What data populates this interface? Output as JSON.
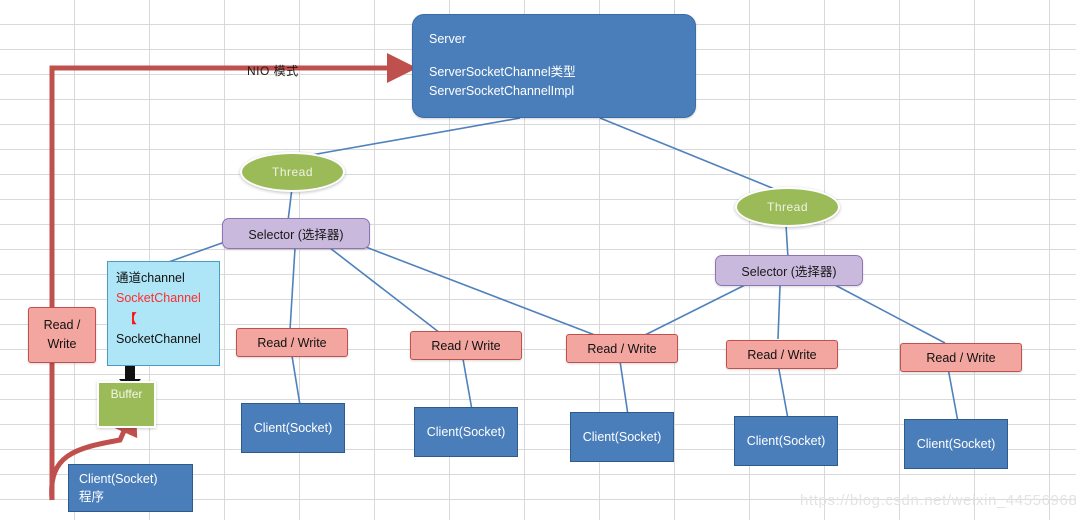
{
  "diagram": {
    "title_label": "NIO 模式",
    "watermark": "https://blog.csdn.net/weixin_44556968",
    "colors": {
      "blue": "#4a7ebb",
      "green": "#9bbb59",
      "purple": "#c9b9dd",
      "pink": "#f3a6a0",
      "cyan": "#aee5f7",
      "red_arrow": "#c0504d",
      "grid": "#d9d9d9",
      "edge_blue": "#4f81bd"
    },
    "server": {
      "line1": "Server",
      "line2": "ServerSocketChannel类型",
      "line3": "ServerSocketChannelImpl"
    },
    "threads": [
      {
        "label": "Thread"
      },
      {
        "label": "Thread"
      }
    ],
    "selectors": [
      {
        "label": "Selector (选择器)"
      },
      {
        "label": "Selector (选择器)"
      }
    ],
    "read_write": [
      {
        "label": "Read /\nWrite"
      },
      {
        "label": "Read / Write"
      },
      {
        "label": "Read / Write"
      },
      {
        "label": "Read / Write"
      },
      {
        "label": "Read / Write"
      },
      {
        "label": "Read / Write"
      }
    ],
    "clients": [
      {
        "label": "Client(Socket)\n程序"
      },
      {
        "label": "Client(Socket)"
      },
      {
        "label": "Client(Socket)"
      },
      {
        "label": "Client(Socket)"
      },
      {
        "label": "Client(Socket)"
      },
      {
        "label": "Client(Socket)"
      }
    ],
    "channel_box": {
      "line1": "通道channel",
      "line2": "SocketChannel",
      "line3": "【",
      "line4": "SocketChannel"
    },
    "buffer": {
      "label": "Buffer"
    }
  }
}
